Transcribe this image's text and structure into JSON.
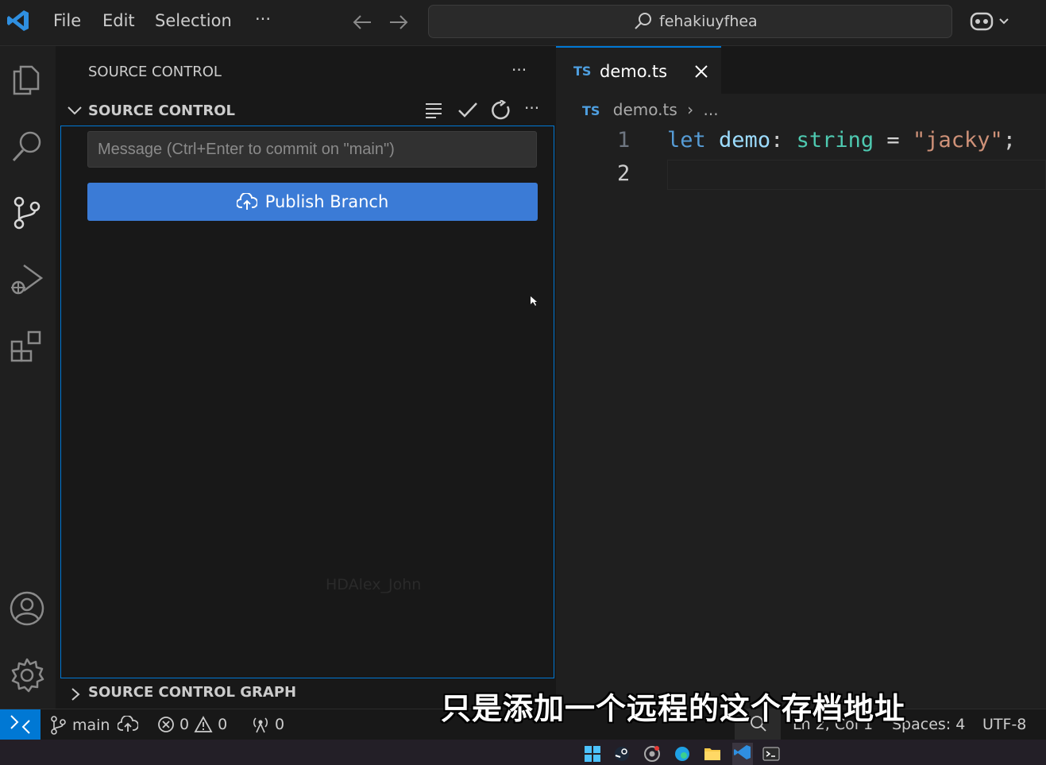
{
  "titlebar": {
    "menu": [
      "File",
      "Edit",
      "Selection"
    ],
    "more_label": "···",
    "search_text": "fehakiuyfhea"
  },
  "sidebar": {
    "title": "SOURCE CONTROL",
    "more_label": "···",
    "section_title": "SOURCE CONTROL",
    "section_more_label": "···",
    "commit_placeholder": "Message (Ctrl+Enter to commit on \"main\")",
    "publish_label": "Publish Branch",
    "watermark": "HDAlex_John",
    "graph_title": "SOURCE CONTROL GRAPH"
  },
  "editor": {
    "tab_badge": "TS",
    "tab_label": "demo.ts",
    "breadcrumb_badge": "TS",
    "breadcrumb_file": "demo.ts",
    "breadcrumb_rest": "...",
    "line_numbers": [
      "1",
      "2"
    ],
    "code": {
      "keyword": "let",
      "identifier": "demo",
      "colon": ":",
      "type": "string",
      "equals": "=",
      "value": "\"jacky\"",
      "semicolon": ";"
    }
  },
  "statusbar": {
    "branch": "main",
    "errors": "0",
    "warnings": "0",
    "ports": "0",
    "position": "Ln 2, Col 1",
    "spaces": "Spaces: 4",
    "encoding": "UTF-8"
  },
  "subtitle": "只是添加一个远程的这个存档地址",
  "colors": {
    "accent": "#0078d4",
    "button": "#3b7bd6",
    "keyword": "#569cd6",
    "type": "#4ec9b0",
    "string": "#ce9178",
    "identifier": "#9cdcfe"
  }
}
